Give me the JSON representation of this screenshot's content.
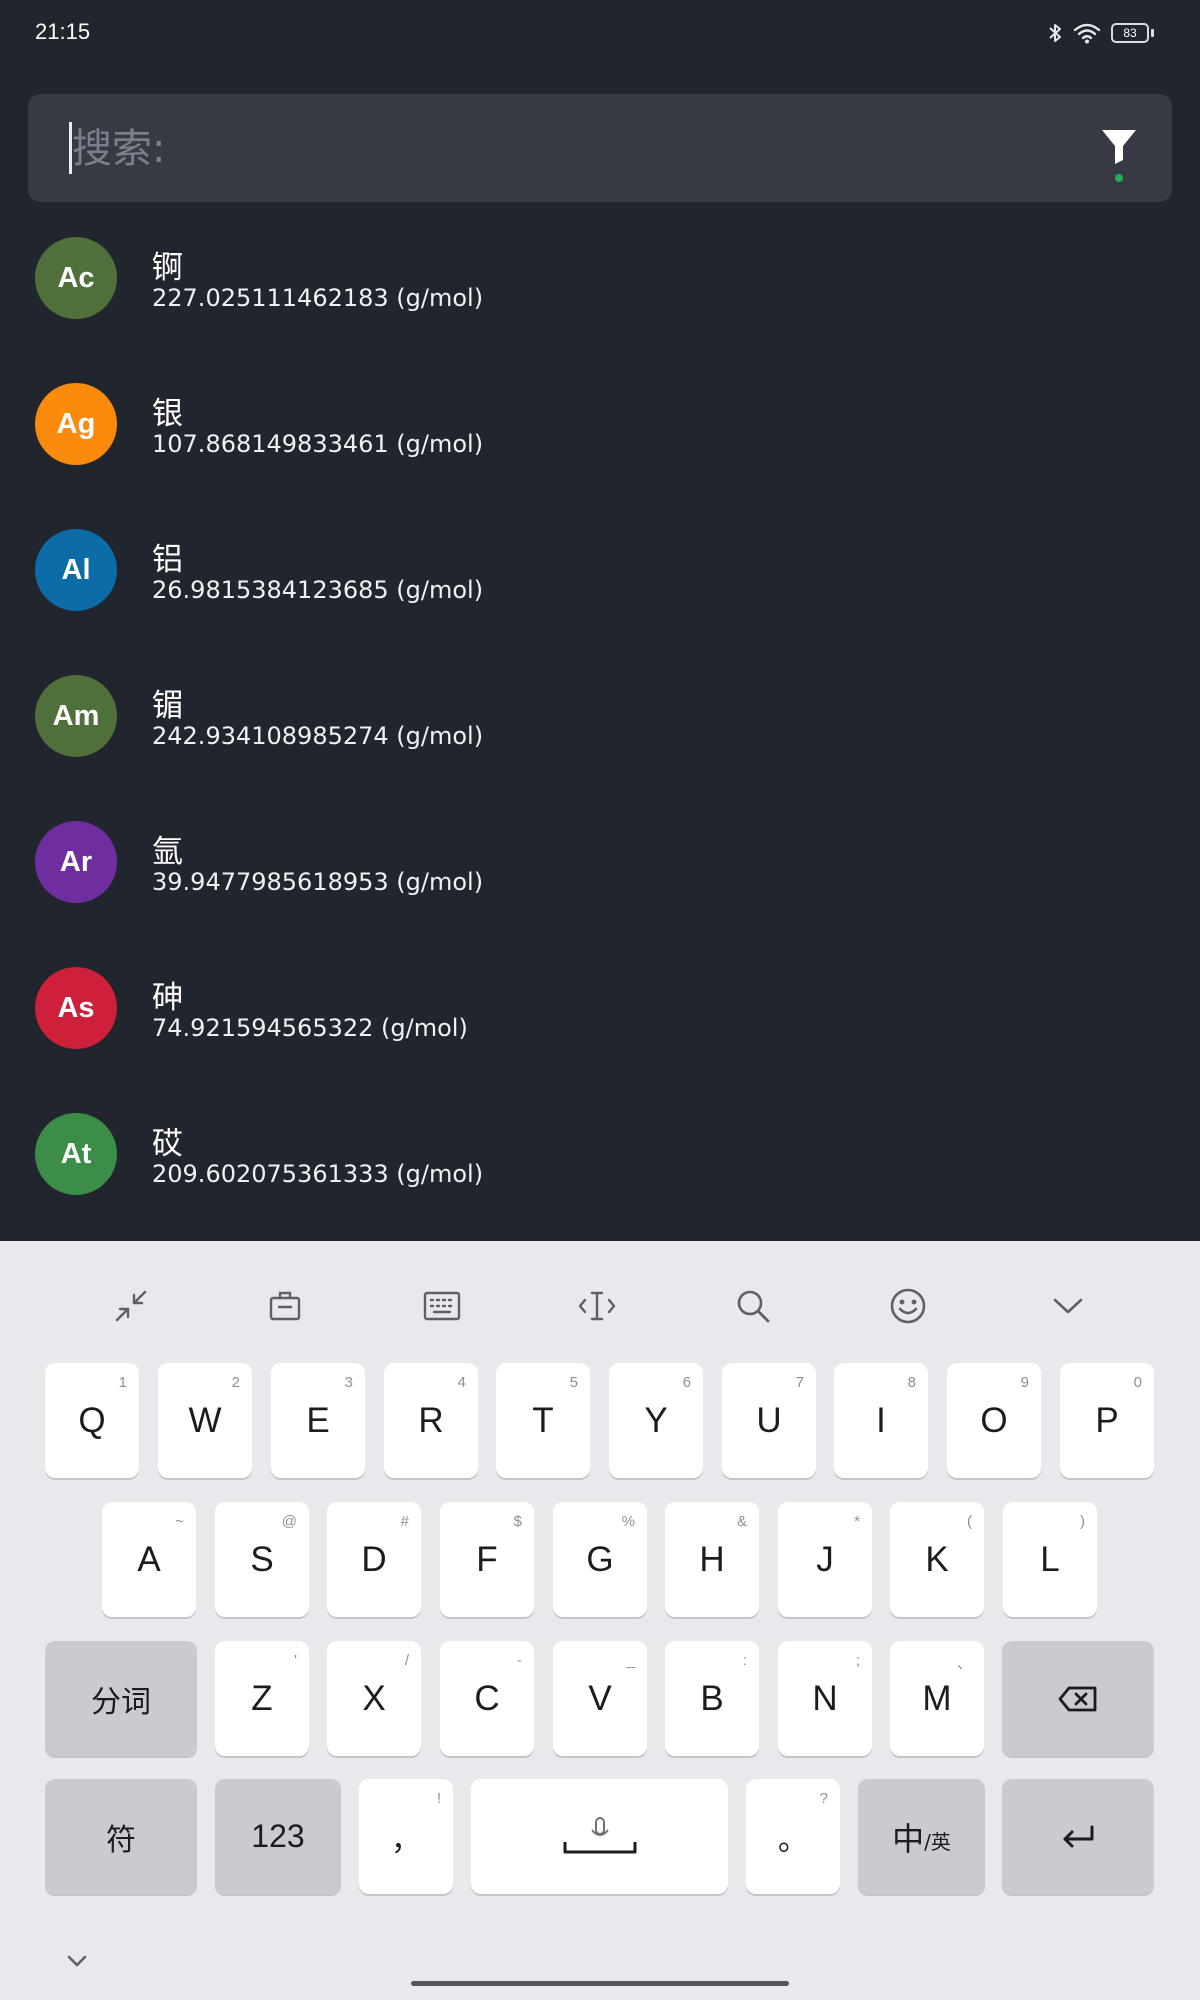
{
  "status_bar": {
    "time": "21:15",
    "battery": "83",
    "icons": [
      "bluetooth-icon",
      "wifi-icon",
      "battery-icon"
    ]
  },
  "search": {
    "placeholder": "搜索:",
    "value": "",
    "filter_icon": "filter-icon",
    "filter_indicator_color": "#1fae5b"
  },
  "elements": [
    {
      "symbol": "Ac",
      "name": "锕",
      "mass": "227.025111462183 (g/mol)",
      "color": "#50703b"
    },
    {
      "symbol": "Ag",
      "name": "银",
      "mass": "107.868149833461 (g/mol)",
      "color": "#fb8b0c"
    },
    {
      "symbol": "Al",
      "name": "铝",
      "mass": "26.9815384123685 (g/mol)",
      "color": "#0b6ca7"
    },
    {
      "symbol": "Am",
      "name": "镅",
      "mass": "242.934108985274 (g/mol)",
      "color": "#50703b"
    },
    {
      "symbol": "Ar",
      "name": "氩",
      "mass": "39.9477985618953 (g/mol)",
      "color": "#6f2ea0"
    },
    {
      "symbol": "As",
      "name": "砷",
      "mass": "74.921594565322 (g/mol)",
      "color": "#cf203b"
    },
    {
      "symbol": "At",
      "name": "砹",
      "mass": "209.602075361333 (g/mol)",
      "color": "#3b8d48"
    }
  ],
  "keyboard": {
    "toolbar": [
      "collapse-icon",
      "clipboard-icon",
      "keyboard-icon",
      "cursor-move-icon",
      "search-icon",
      "emoji-icon",
      "chevron-down-icon"
    ],
    "row1": [
      {
        "main": "Q",
        "sub": "1"
      },
      {
        "main": "W",
        "sub": "2"
      },
      {
        "main": "E",
        "sub": "3"
      },
      {
        "main": "R",
        "sub": "4"
      },
      {
        "main": "T",
        "sub": "5"
      },
      {
        "main": "Y",
        "sub": "6"
      },
      {
        "main": "U",
        "sub": "7"
      },
      {
        "main": "I",
        "sub": "8"
      },
      {
        "main": "O",
        "sub": "9"
      },
      {
        "main": "P",
        "sub": "0"
      }
    ],
    "row2": [
      {
        "main": "A",
        "sub": "~"
      },
      {
        "main": "S",
        "sub": "@"
      },
      {
        "main": "D",
        "sub": "#"
      },
      {
        "main": "F",
        "sub": "$"
      },
      {
        "main": "G",
        "sub": "%"
      },
      {
        "main": "H",
        "sub": "&"
      },
      {
        "main": "J",
        "sub": "*"
      },
      {
        "main": "K",
        "sub": "("
      },
      {
        "main": "L",
        "sub": ")"
      }
    ],
    "segment_label": "分词",
    "row3": [
      {
        "main": "Z",
        "sub": "'"
      },
      {
        "main": "X",
        "sub": "/"
      },
      {
        "main": "C",
        "sub": "-"
      },
      {
        "main": "V",
        "sub": "_"
      },
      {
        "main": "B",
        "sub": ":"
      },
      {
        "main": "N",
        "sub": ";"
      },
      {
        "main": "M",
        "sub": "、"
      }
    ],
    "symbols_label": "符",
    "numbers_label": "123",
    "comma": {
      "main": "，",
      "sub": "!"
    },
    "period": {
      "main": "。",
      "sub": "?"
    },
    "lang_main": "中",
    "lang_sub": "/英"
  }
}
